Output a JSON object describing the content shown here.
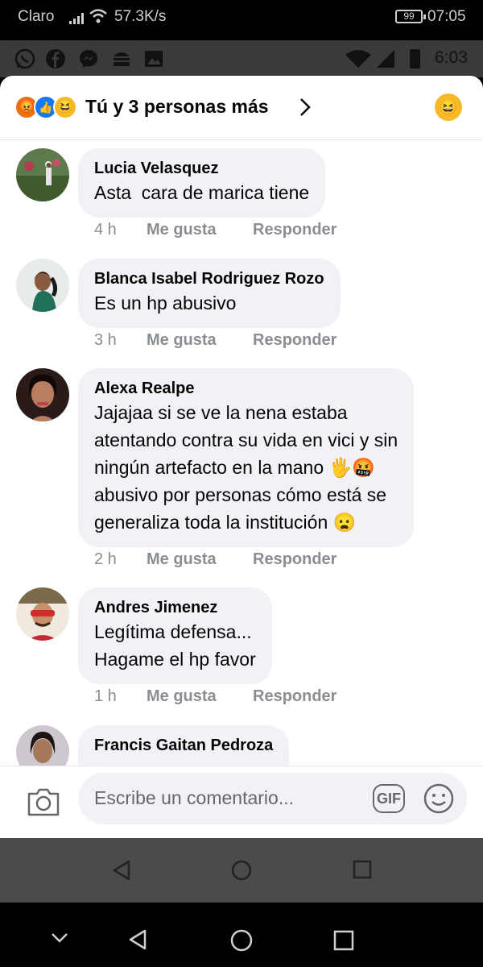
{
  "status_outer": {
    "carrier": "Claro",
    "speed": "57.3K/s",
    "battery": "99",
    "time": "07:05"
  },
  "status_inner": {
    "time": "6:03",
    "icons": [
      "whatsapp-icon",
      "facebook-icon",
      "messenger-icon",
      "burger-icon",
      "gallery-icon"
    ]
  },
  "reactions": {
    "emojis": [
      "angry",
      "like",
      "haha"
    ],
    "summary": "Tú y 3 personas más",
    "my_reaction": "haha"
  },
  "comments": [
    {
      "author": "Lucia Velasquez",
      "text": "Asta  cara de marica tiene",
      "time": "4 h",
      "like_label": "Me gusta",
      "reply_label": "Responder"
    },
    {
      "author": "Blanca Isabel Rodriguez Rozo",
      "text": "Es un hp abusivo",
      "time": "3 h",
      "like_label": "Me gusta",
      "reply_label": "Responder"
    },
    {
      "author": "Alexa Realpe",
      "text": "Jajajaa si se ve la nena estaba\natentando contra su vida en vici y sin\nningún artefacto en la mano 🖐️🤬\nabusivo por personas cómo está se\ngeneraliza toda la institución 😦",
      "time": "2 h",
      "like_label": "Me gusta",
      "reply_label": "Responder"
    },
    {
      "author": "Andres Jimenez",
      "text": "Legítima defensa...\nHagame el hp favor",
      "time": "1 h",
      "like_label": "Me gusta",
      "reply_label": "Responder"
    },
    {
      "author": "Francis Gaitan Pedroza",
      "text": "",
      "time": "",
      "like_label": "",
      "reply_label": ""
    }
  ],
  "composer": {
    "placeholder": "Escribe un comentario...",
    "gif_label": "GIF"
  }
}
